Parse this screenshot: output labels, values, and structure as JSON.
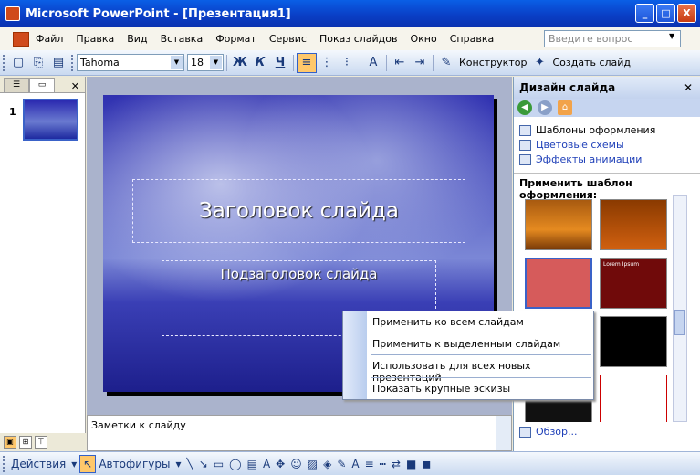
{
  "window": {
    "title": "Microsoft PowerPoint - [Презентация1]",
    "min": "_",
    "max": "□",
    "close": "X"
  },
  "menu": {
    "items": [
      "Файл",
      "Правка",
      "Вид",
      "Вставка",
      "Формат",
      "Сервис",
      "Показ слайдов",
      "Окно",
      "Справка"
    ],
    "ask_placeholder": "Введите вопрос"
  },
  "toolbar": {
    "font": "Tahoma",
    "size": "18",
    "bold": "Ж",
    "italic": "К",
    "underline": "Ч",
    "constructor": "Конструктор",
    "new_slide": "Создать слайд"
  },
  "slides_pane": {
    "slide_number": "1"
  },
  "slide": {
    "title": "Заголовок слайда",
    "subtitle": "Подзаголовок слайда"
  },
  "notes": {
    "text": "Заметки к слайду"
  },
  "taskpane": {
    "title": "Дизайн слайда",
    "links": [
      "Шаблоны оформления",
      "Цветовые схемы",
      "Эффекты анимации"
    ],
    "section": "Применить шаблон оформления:",
    "browse": "Обзор...",
    "template_caption": "Lorem Ipsum"
  },
  "context_menu": {
    "items": [
      "Применить ко всем слайдам",
      "Применить к выделенным слайдам",
      "Использовать для всех новых презентаций",
      "Показать крупные эскизы"
    ]
  },
  "drawing": {
    "actions": "Действия",
    "autoshapes": "Автофигуры"
  }
}
